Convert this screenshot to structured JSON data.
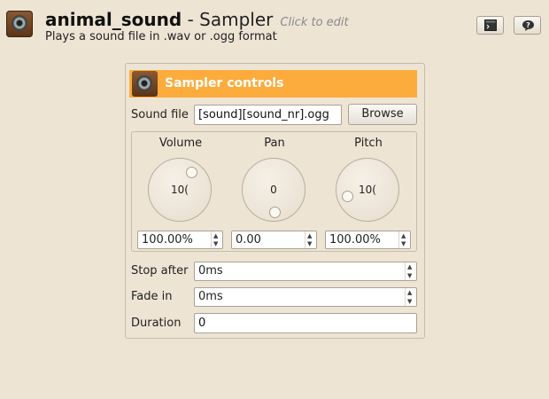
{
  "header": {
    "name": "animal_sound",
    "separator": " - ",
    "type": "Sampler",
    "click_to_edit": "Click to edit",
    "description": "Plays a sound file in .wav or .ogg format"
  },
  "panel": {
    "title": "Sampler controls",
    "sound_file_label": "Sound file",
    "sound_file_value": "[sound][sound_nr].ogg",
    "browse_label": "Browse",
    "knobs": [
      {
        "label": "Volume",
        "display": "10(",
        "value": "100.00%",
        "level": 1.0
      },
      {
        "label": "Pan",
        "display": "0",
        "value": "0.00",
        "level": 0.5
      },
      {
        "label": "Pitch",
        "display": "10(",
        "value": "100.00%",
        "level": 0.25
      }
    ],
    "stop_after_label": "Stop after",
    "stop_after_value": "0ms",
    "fade_in_label": "Fade in",
    "fade_in_value": "0ms",
    "duration_label": "Duration",
    "duration_value": "0"
  },
  "icons": {
    "app": "speaker-icon",
    "terminal": "terminal-icon",
    "help": "help-icon"
  }
}
